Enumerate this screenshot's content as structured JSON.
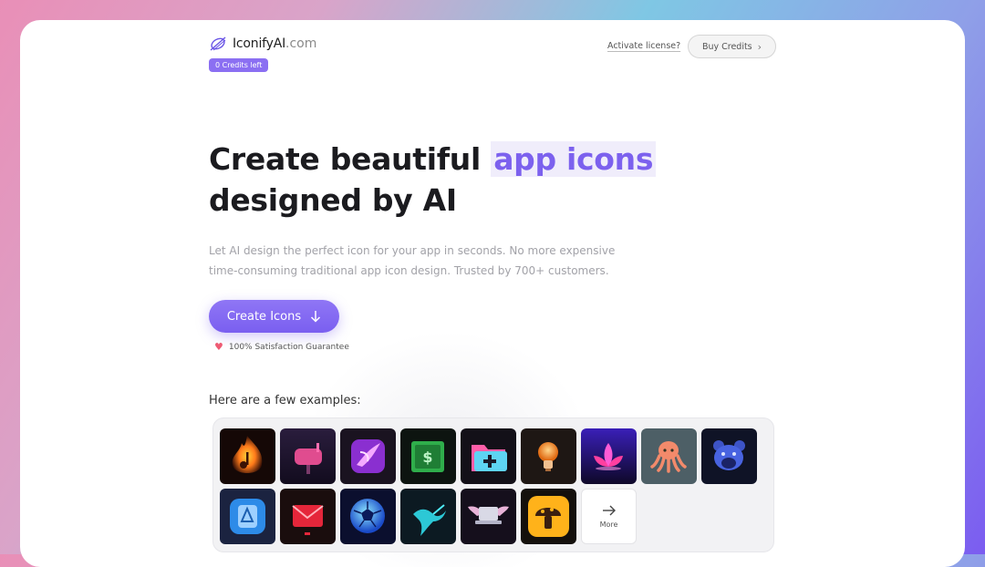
{
  "header": {
    "brand_name": "IconifyAI",
    "brand_domain": ".com",
    "credits_badge": "0 Credits left",
    "activate_link": "Activate license?",
    "buy_button": "Buy Credits"
  },
  "hero": {
    "title_part1": "Create beautiful ",
    "title_highlight": "app icons",
    "title_part2": "designed by AI",
    "subtitle": "Let AI design the perfect icon for your app in seconds. No more expensive time-consuming traditional app icon design. Trusted by 700+ customers.",
    "cta_button": "Create Icons",
    "guarantee": "100% Satisfaction Guarantee"
  },
  "examples": {
    "label": "Here are a few examples:",
    "more_label": "More",
    "icons": [
      {
        "name": "fire-music-icon"
      },
      {
        "name": "mailbox-icon"
      },
      {
        "name": "purple-bird-icon"
      },
      {
        "name": "money-book-icon"
      },
      {
        "name": "folder-plus-icon"
      },
      {
        "name": "lightbulb-icon"
      },
      {
        "name": "lotus-icon"
      },
      {
        "name": "octopus-icon"
      },
      {
        "name": "bear-icon"
      },
      {
        "name": "blue-app-icon"
      },
      {
        "name": "red-envelope-icon"
      },
      {
        "name": "soccer-ball-icon"
      },
      {
        "name": "hummingbird-icon"
      },
      {
        "name": "winged-laptop-icon"
      },
      {
        "name": "mushroom-icon"
      }
    ]
  },
  "colors": {
    "accent": "#7c61ee",
    "heart": "#ee5a73"
  }
}
